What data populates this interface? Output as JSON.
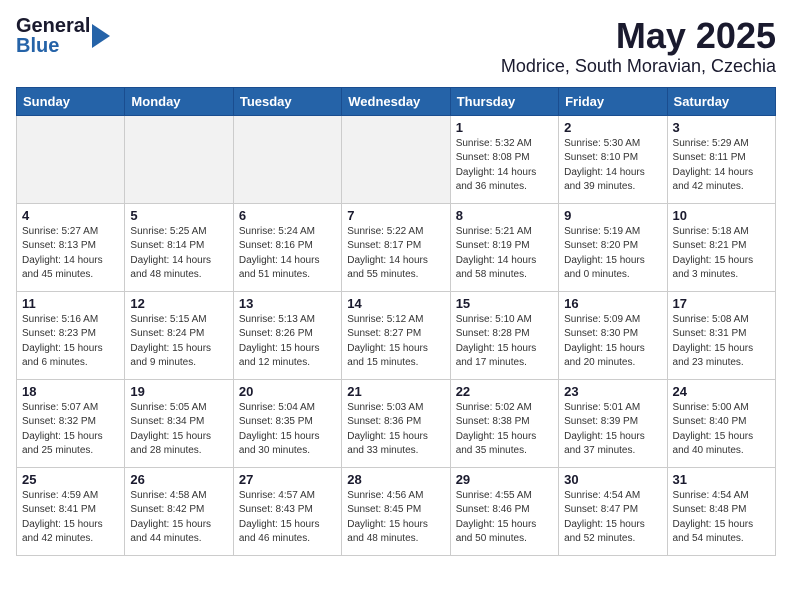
{
  "header": {
    "logo_general": "General",
    "logo_blue": "Blue",
    "title": "May 2025",
    "subtitle": "Modrice, South Moravian, Czechia"
  },
  "days_of_week": [
    "Sunday",
    "Monday",
    "Tuesday",
    "Wednesday",
    "Thursday",
    "Friday",
    "Saturday"
  ],
  "weeks": [
    [
      {
        "day": "",
        "info": "",
        "shaded": true
      },
      {
        "day": "",
        "info": "",
        "shaded": true
      },
      {
        "day": "",
        "info": "",
        "shaded": true
      },
      {
        "day": "",
        "info": "",
        "shaded": true
      },
      {
        "day": "1",
        "info": "Sunrise: 5:32 AM\nSunset: 8:08 PM\nDaylight: 14 hours\nand 36 minutes."
      },
      {
        "day": "2",
        "info": "Sunrise: 5:30 AM\nSunset: 8:10 PM\nDaylight: 14 hours\nand 39 minutes."
      },
      {
        "day": "3",
        "info": "Sunrise: 5:29 AM\nSunset: 8:11 PM\nDaylight: 14 hours\nand 42 minutes."
      }
    ],
    [
      {
        "day": "4",
        "info": "Sunrise: 5:27 AM\nSunset: 8:13 PM\nDaylight: 14 hours\nand 45 minutes."
      },
      {
        "day": "5",
        "info": "Sunrise: 5:25 AM\nSunset: 8:14 PM\nDaylight: 14 hours\nand 48 minutes."
      },
      {
        "day": "6",
        "info": "Sunrise: 5:24 AM\nSunset: 8:16 PM\nDaylight: 14 hours\nand 51 minutes."
      },
      {
        "day": "7",
        "info": "Sunrise: 5:22 AM\nSunset: 8:17 PM\nDaylight: 14 hours\nand 55 minutes."
      },
      {
        "day": "8",
        "info": "Sunrise: 5:21 AM\nSunset: 8:19 PM\nDaylight: 14 hours\nand 58 minutes."
      },
      {
        "day": "9",
        "info": "Sunrise: 5:19 AM\nSunset: 8:20 PM\nDaylight: 15 hours\nand 0 minutes."
      },
      {
        "day": "10",
        "info": "Sunrise: 5:18 AM\nSunset: 8:21 PM\nDaylight: 15 hours\nand 3 minutes."
      }
    ],
    [
      {
        "day": "11",
        "info": "Sunrise: 5:16 AM\nSunset: 8:23 PM\nDaylight: 15 hours\nand 6 minutes."
      },
      {
        "day": "12",
        "info": "Sunrise: 5:15 AM\nSunset: 8:24 PM\nDaylight: 15 hours\nand 9 minutes."
      },
      {
        "day": "13",
        "info": "Sunrise: 5:13 AM\nSunset: 8:26 PM\nDaylight: 15 hours\nand 12 minutes."
      },
      {
        "day": "14",
        "info": "Sunrise: 5:12 AM\nSunset: 8:27 PM\nDaylight: 15 hours\nand 15 minutes."
      },
      {
        "day": "15",
        "info": "Sunrise: 5:10 AM\nSunset: 8:28 PM\nDaylight: 15 hours\nand 17 minutes."
      },
      {
        "day": "16",
        "info": "Sunrise: 5:09 AM\nSunset: 8:30 PM\nDaylight: 15 hours\nand 20 minutes."
      },
      {
        "day": "17",
        "info": "Sunrise: 5:08 AM\nSunset: 8:31 PM\nDaylight: 15 hours\nand 23 minutes."
      }
    ],
    [
      {
        "day": "18",
        "info": "Sunrise: 5:07 AM\nSunset: 8:32 PM\nDaylight: 15 hours\nand 25 minutes."
      },
      {
        "day": "19",
        "info": "Sunrise: 5:05 AM\nSunset: 8:34 PM\nDaylight: 15 hours\nand 28 minutes."
      },
      {
        "day": "20",
        "info": "Sunrise: 5:04 AM\nSunset: 8:35 PM\nDaylight: 15 hours\nand 30 minutes."
      },
      {
        "day": "21",
        "info": "Sunrise: 5:03 AM\nSunset: 8:36 PM\nDaylight: 15 hours\nand 33 minutes."
      },
      {
        "day": "22",
        "info": "Sunrise: 5:02 AM\nSunset: 8:38 PM\nDaylight: 15 hours\nand 35 minutes."
      },
      {
        "day": "23",
        "info": "Sunrise: 5:01 AM\nSunset: 8:39 PM\nDaylight: 15 hours\nand 37 minutes."
      },
      {
        "day": "24",
        "info": "Sunrise: 5:00 AM\nSunset: 8:40 PM\nDaylight: 15 hours\nand 40 minutes."
      }
    ],
    [
      {
        "day": "25",
        "info": "Sunrise: 4:59 AM\nSunset: 8:41 PM\nDaylight: 15 hours\nand 42 minutes."
      },
      {
        "day": "26",
        "info": "Sunrise: 4:58 AM\nSunset: 8:42 PM\nDaylight: 15 hours\nand 44 minutes."
      },
      {
        "day": "27",
        "info": "Sunrise: 4:57 AM\nSunset: 8:43 PM\nDaylight: 15 hours\nand 46 minutes."
      },
      {
        "day": "28",
        "info": "Sunrise: 4:56 AM\nSunset: 8:45 PM\nDaylight: 15 hours\nand 48 minutes."
      },
      {
        "day": "29",
        "info": "Sunrise: 4:55 AM\nSunset: 8:46 PM\nDaylight: 15 hours\nand 50 minutes."
      },
      {
        "day": "30",
        "info": "Sunrise: 4:54 AM\nSunset: 8:47 PM\nDaylight: 15 hours\nand 52 minutes."
      },
      {
        "day": "31",
        "info": "Sunrise: 4:54 AM\nSunset: 8:48 PM\nDaylight: 15 hours\nand 54 minutes."
      }
    ]
  ]
}
